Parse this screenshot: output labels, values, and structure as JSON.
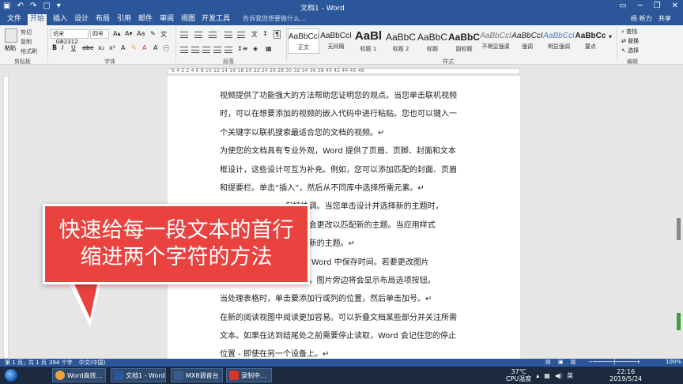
{
  "titlebar": {
    "title": "文档1 - Word"
  },
  "tabs": [
    "文件",
    "开始",
    "插入",
    "设计",
    "布局",
    "引用",
    "邮件",
    "审阅",
    "视图",
    "开发工具"
  ],
  "tell_me": "告诉我您想要做什么...",
  "user": "杨 新力",
  "share": "共享",
  "clipboard": {
    "paste": "粘贴",
    "cut": "剪切",
    "copy": "复制",
    "format_painter": "格式刷",
    "group": "剪贴板"
  },
  "font": {
    "name": "仿宋_GB2312",
    "size": "四号",
    "group": "字体"
  },
  "paragraph": {
    "group": "段落"
  },
  "styles": {
    "group": "样式",
    "items": [
      {
        "sample": "AaBbCcI",
        "name": "正文"
      },
      {
        "sample": "AaBbCcI",
        "name": "无间隔"
      },
      {
        "sample": "AaBl",
        "name": "标题 1"
      },
      {
        "sample": "AaBbC",
        "name": "标题 2"
      },
      {
        "sample": "AaBbC",
        "name": "标题"
      },
      {
        "sample": "AaBbC",
        "name": "副标题"
      },
      {
        "sample": "AaBbCcI",
        "name": "不明显强调"
      },
      {
        "sample": "AaBbCcI",
        "name": "强调"
      },
      {
        "sample": "AaBbCcI",
        "name": "明显强调"
      },
      {
        "sample": "AaBbCc",
        "name": "要点"
      }
    ]
  },
  "editing": {
    "find": "查找",
    "replace": "替换",
    "select": "选择",
    "group": "编辑"
  },
  "ruler_numbers": "6 4 2   2 4 6 8 10 12 14 16 18 20 22 24 26 28 30 32 34 36 38 40 42 44 46 48",
  "document": {
    "lines": [
      "视频提供了功能强大的方法帮助您证明您的观点。当您单击联机视频",
      "时，可以在想要添加的视频的嵌入代码中进行粘贴。您也可以键入一",
      "个关键字以联机搜索最适合您的文档的视频。↵",
      "为使您的文档具有专业外观，Word 提供了页眉、页脚、封面和文本",
      "框设计，这些设计可互为补充。例如，您可以添加匹配的封面、页眉",
      "和提要栏。单击“插入”，然后从不同库中选择所需元素。↵",
      "                          保持协调。当您单击设计并选择新的主题时，",
      "                          图形将会更改以匹配新的主题。当应用样式",
      "                          以匹配新的主题。↵",
      "                          按钮在 Word 中保存时间。若要更改图片",
      "                          该图片，图片旁边将会显示布局选项按钮。",
      "当处理表格时，单击要添加行或列的位置，然后单击加号。↵",
      "在新的阅读视图中阅读更加容易。可以折叠文档某些部分并关注所需",
      "文本。如果在达到结尾处之前需要停止读取，Word 会记住您的停止",
      "位置 - 即使在另一个设备上。↵"
    ]
  },
  "callout": {
    "line1": "快速给每一段文本的首行",
    "line2": "缩进两个字符的方法"
  },
  "status": {
    "page": "第 1 页，共 1 页",
    "words": "394 个字",
    "lang": "中文(中国)",
    "zoom": "100%"
  },
  "taskbar": {
    "items": [
      {
        "label": "Word高效...",
        "icon": "browser-icon",
        "color": "#e8a33d"
      },
      {
        "label": "文档1 - Word",
        "icon": "word-icon",
        "color": "#2b579a"
      },
      {
        "label": "MX8调音台",
        "icon": "mixer-icon",
        "color": "#3b5b8c"
      },
      {
        "label": "录制中...",
        "icon": "record-icon",
        "color": "#d9342b"
      }
    ],
    "temp": "37℃",
    "temp_label": "CPU温度",
    "time": "22:16",
    "date": "2019/5/24"
  }
}
